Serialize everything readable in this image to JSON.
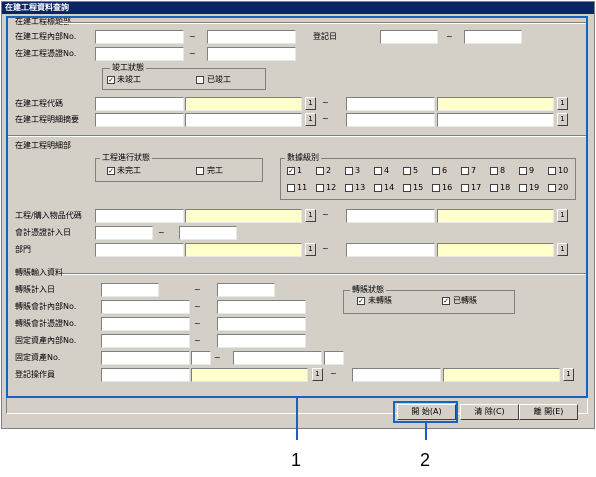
{
  "window": {
    "title": "在建工程資料查詢"
  },
  "sec1": {
    "title": "在建工程標題部",
    "row1_label": "在建工程內部No.",
    "tilde": "~",
    "row2_label": "在建工程憑證No.",
    "reg_date_label": "登記日",
    "status_group": "竣工狀態",
    "status_unfinished": "未竣工",
    "status_finished": "已竣工",
    "unfinished_checked": "✓",
    "code_label": "在建工程代碼",
    "detail_label": "在建工程明細摘要",
    "pick": "1"
  },
  "sec2": {
    "title": "在建工程明細部",
    "progress_group": "工程進行狀態",
    "progress_unfinished": "未完工",
    "progress_finished": "完工",
    "checked": "✓",
    "level_group": "數據級別",
    "levels": [
      "1",
      "2",
      "3",
      "4",
      "5",
      "6",
      "7",
      "8",
      "9",
      "10",
      "11",
      "12",
      "13",
      "14",
      "15",
      "16",
      "17",
      "18",
      "19",
      "20"
    ],
    "item_code_label": "工程/購入物品代碼",
    "acct_date_label": "會計憑證計入日",
    "dept_label": "部門"
  },
  "sec3": {
    "title": "轉賬輸入資料",
    "transfer_date_label": "轉賬計入日",
    "acct_internal_label": "轉賬會計內部No.",
    "acct_voucher_label": "轉賬會計憑證No.",
    "asset_internal_label": "固定資產內部No.",
    "asset_no_label": "固定資產No.",
    "operator_label": "登記操作員",
    "transfer_group": "轉賬狀態",
    "not_transferred": "未轉賬",
    "transferred": "已轉賬"
  },
  "buttons": {
    "start": "開 始(A)",
    "clear": "清 除(C)",
    "close": "離 開(E)"
  },
  "callouts": {
    "one": "1",
    "two": "2"
  },
  "colors": {
    "title_bg": "#0a246a",
    "window_bg": "#d4d0c8",
    "yellow_field": "#ffffcc",
    "callout": "#1565c0"
  }
}
